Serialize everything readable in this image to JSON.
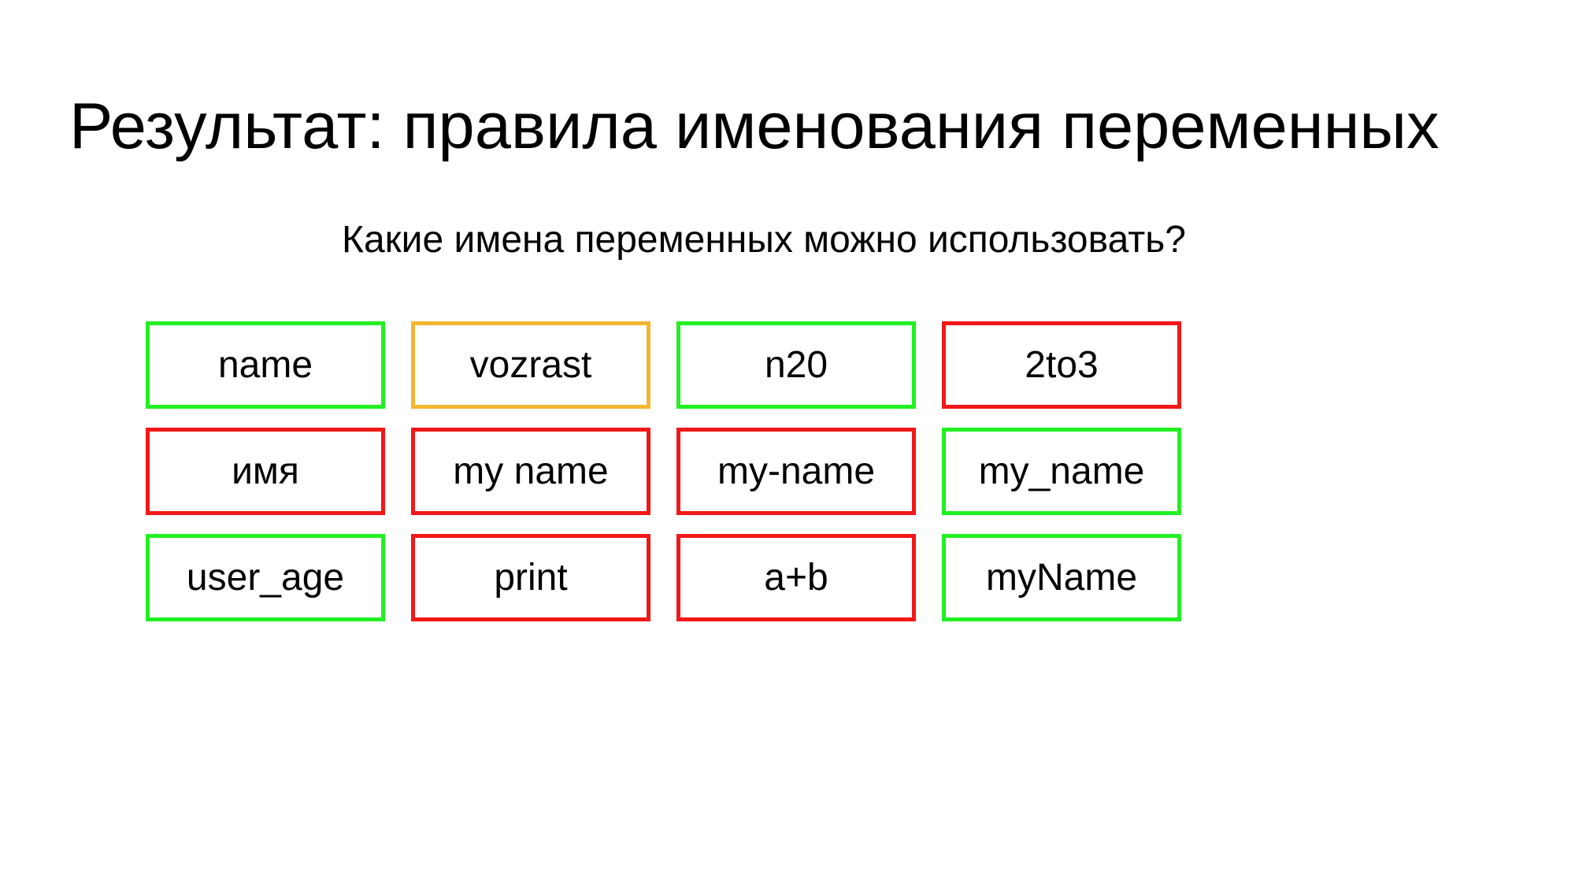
{
  "slide": {
    "title": "Результат: правила именования переменных",
    "subtitle": "Какие имена переменных можно использовать?"
  },
  "colors": {
    "valid": "#22f022",
    "invalid": "#f21818",
    "warning": "#f2b731"
  },
  "cards": [
    {
      "label": "name",
      "status": "valid"
    },
    {
      "label": "vozrast",
      "status": "warning"
    },
    {
      "label": "n20",
      "status": "valid"
    },
    {
      "label": "2to3",
      "status": "invalid"
    },
    {
      "label": "имя",
      "status": "invalid"
    },
    {
      "label": "my name",
      "status": "invalid"
    },
    {
      "label": "my-name",
      "status": "invalid"
    },
    {
      "label": "my_name",
      "status": "valid"
    },
    {
      "label": "user_age",
      "status": "valid"
    },
    {
      "label": "print",
      "status": "invalid"
    },
    {
      "label": "a+b",
      "status": "invalid"
    },
    {
      "label": "myName",
      "status": "valid"
    }
  ]
}
